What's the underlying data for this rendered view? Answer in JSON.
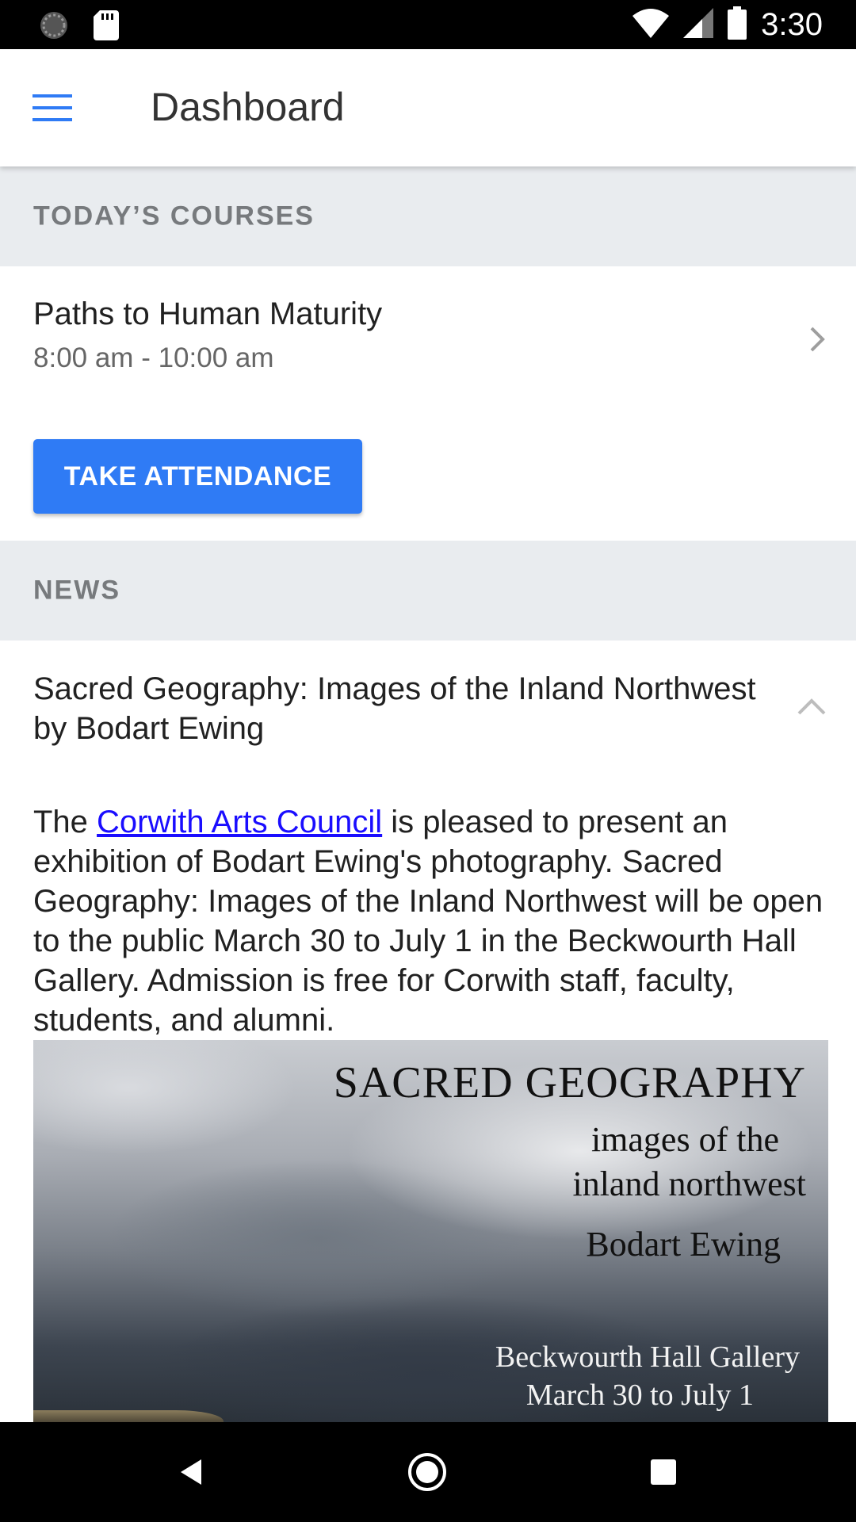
{
  "status_bar": {
    "time": "3:30",
    "icons": [
      "sync-icon",
      "sd-card-icon",
      "wifi-icon",
      "signal-icon",
      "battery-icon"
    ]
  },
  "app_bar": {
    "title": "Dashboard",
    "menu_icon": "hamburger-menu-icon",
    "accent": "#2f7bf5"
  },
  "courses_section": {
    "header": "TODAY’S COURSES",
    "items": [
      {
        "title": "Paths to Human Maturity",
        "time": "8:00 am - 10:00 am"
      }
    ],
    "action_label": "TAKE ATTENDANCE"
  },
  "news_section": {
    "header": "NEWS",
    "item": {
      "title": "Sacred Geography: Images of the Inland Northwest by Bodart Ewing",
      "body_prefix": "The ",
      "body_link": "Corwith Arts Council",
      "body_suffix": " is pleased to present an exhibition of Bodart Ewing's photography. Sacred Geography: Images of the Inland Northwest will be open to the public March 30 to July 1 in the Beckwourth Hall Gallery. Admission is free for Corwith staff, faculty, students, and alumni.",
      "poster": {
        "title": "SACRED GEOGRAPHY",
        "subtitle_line1": "images of the",
        "subtitle_line2": "inland northwest",
        "artist": "Bodart Ewing",
        "venue": "Beckwourth Hall Gallery",
        "dates": "March 30 to July 1"
      }
    }
  },
  "nav_bar": {
    "buttons": [
      "back-icon",
      "home-icon",
      "recents-icon"
    ]
  }
}
